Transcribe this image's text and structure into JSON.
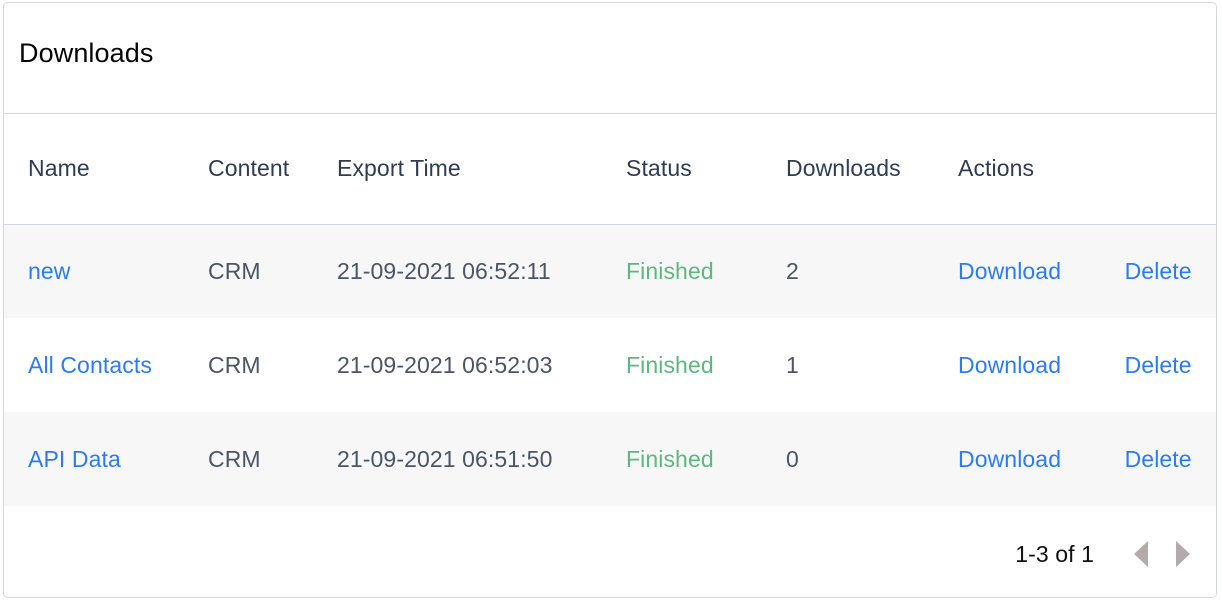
{
  "card": {
    "title": "Downloads"
  },
  "table": {
    "columns": [
      {
        "key": "name",
        "label": "Name"
      },
      {
        "key": "content",
        "label": "Content"
      },
      {
        "key": "time",
        "label": "Export Time"
      },
      {
        "key": "status",
        "label": "Status"
      },
      {
        "key": "downloads",
        "label": "Downloads"
      },
      {
        "key": "actions",
        "label": "Actions"
      }
    ],
    "rows": [
      {
        "name": "new",
        "content": "CRM",
        "time": "21-09-2021 06:52:11",
        "status": "Finished",
        "downloads": "2",
        "download_label": "Download",
        "delete_label": "Delete"
      },
      {
        "name": "All Contacts",
        "content": "CRM",
        "time": "21-09-2021 06:52:03",
        "status": "Finished",
        "downloads": "1",
        "download_label": "Download",
        "delete_label": "Delete"
      },
      {
        "name": "API Data",
        "content": "CRM",
        "time": "21-09-2021 06:51:50",
        "status": "Finished",
        "downloads": "0",
        "download_label": "Download",
        "delete_label": "Delete"
      }
    ]
  },
  "pagination": {
    "range": "1-3 of 1",
    "prev_icon": "triangle-left-icon",
    "next_icon": "triangle-right-icon"
  },
  "colors": {
    "link": "#2a7cf4",
    "status_finished": "#5cb87f",
    "header_text": "#2e3c54",
    "body_text": "#4a5568",
    "border": "#d3d6dc",
    "stripe": "#f7f7f8",
    "pager_arrow": "#b5aaaa"
  }
}
